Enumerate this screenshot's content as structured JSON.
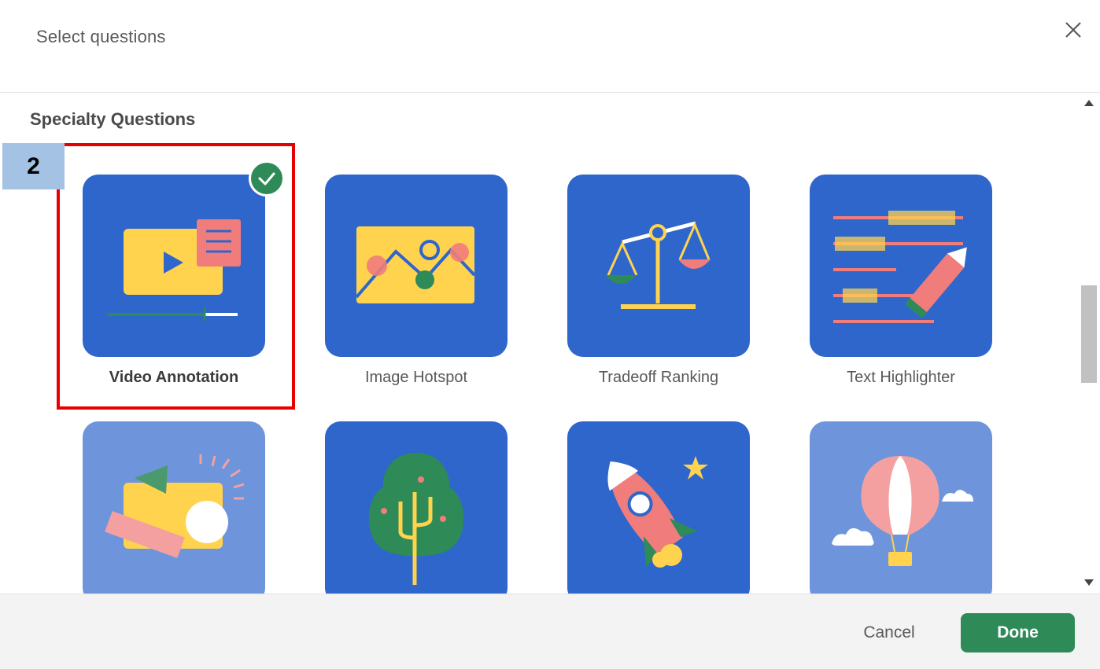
{
  "dialog": {
    "title": "Select questions",
    "close_icon": "close-icon"
  },
  "section": {
    "title": "Specialty Questions"
  },
  "cards": [
    {
      "label": "Video Annotation",
      "selected": true,
      "icon": "video-annotation-icon"
    },
    {
      "label": "Image Hotspot",
      "selected": false,
      "icon": "image-hotspot-icon"
    },
    {
      "label": "Tradeoff Ranking",
      "selected": false,
      "icon": "tradeoff-ranking-icon"
    },
    {
      "label": "Text Highlighter",
      "selected": false,
      "icon": "text-highlighter-icon"
    },
    {
      "label": "",
      "selected": false,
      "icon": "creative-shapes-icon"
    },
    {
      "label": "",
      "selected": false,
      "icon": "tree-icon"
    },
    {
      "label": "",
      "selected": false,
      "icon": "rocket-icon"
    },
    {
      "label": "",
      "selected": false,
      "icon": "hot-air-balloon-icon"
    }
  ],
  "annotation": {
    "step_number": "2"
  },
  "footer": {
    "cancel_label": "Cancel",
    "done_label": "Done"
  },
  "colors": {
    "tile_blue": "#2f66cc",
    "tile_light_blue": "#6e95dc",
    "accent_green": "#2e8b57",
    "highlight_red": "#e80000",
    "step_badge_bg": "#a4c2e4"
  }
}
